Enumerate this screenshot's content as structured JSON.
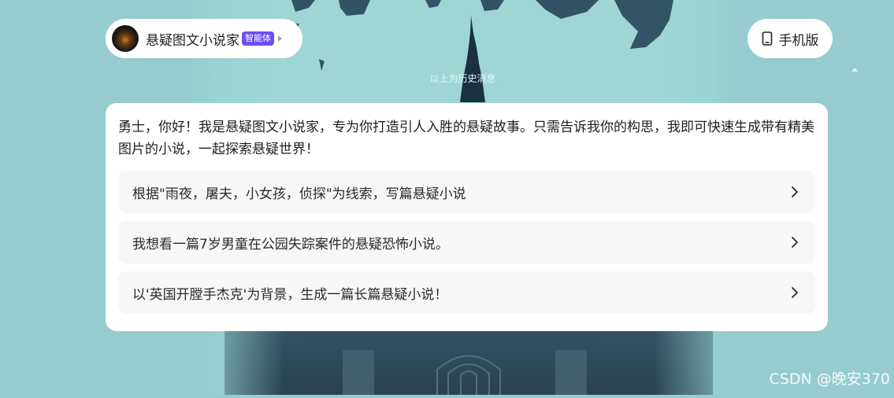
{
  "agent": {
    "name": "悬疑图文小说家",
    "badge": "智能体"
  },
  "header": {
    "mobile_label": "手机版"
  },
  "history_note": "以上为历史消息",
  "message": {
    "greeting": "勇士，你好！我是悬疑图文小说家，专为你打造引人入胜的悬疑故事。只需告诉我你的构思，我即可快速生成带有精美图片的小说，一起探索悬疑世界！"
  },
  "suggestions": [
    {
      "label": "根据\"雨夜，屠夫，小女孩，侦探\"为线索，写篇悬疑小说"
    },
    {
      "label": "我想看一篇7岁男童在公园失踪案件的悬疑恐怖小说。"
    },
    {
      "label": "以'英国开膛手杰克'为背景，生成一篇长篇悬疑小说！"
    }
  ],
  "watermark": "CSDN @晚安370",
  "colors": {
    "background": "#96cccd",
    "badge": "#6e4cf2",
    "card": "#ffffff",
    "suggestion_bg": "#f6f7f9"
  },
  "icons": [
    "avatar",
    "phone-icon",
    "chevron-right-icon",
    "scroll-up-icon"
  ]
}
